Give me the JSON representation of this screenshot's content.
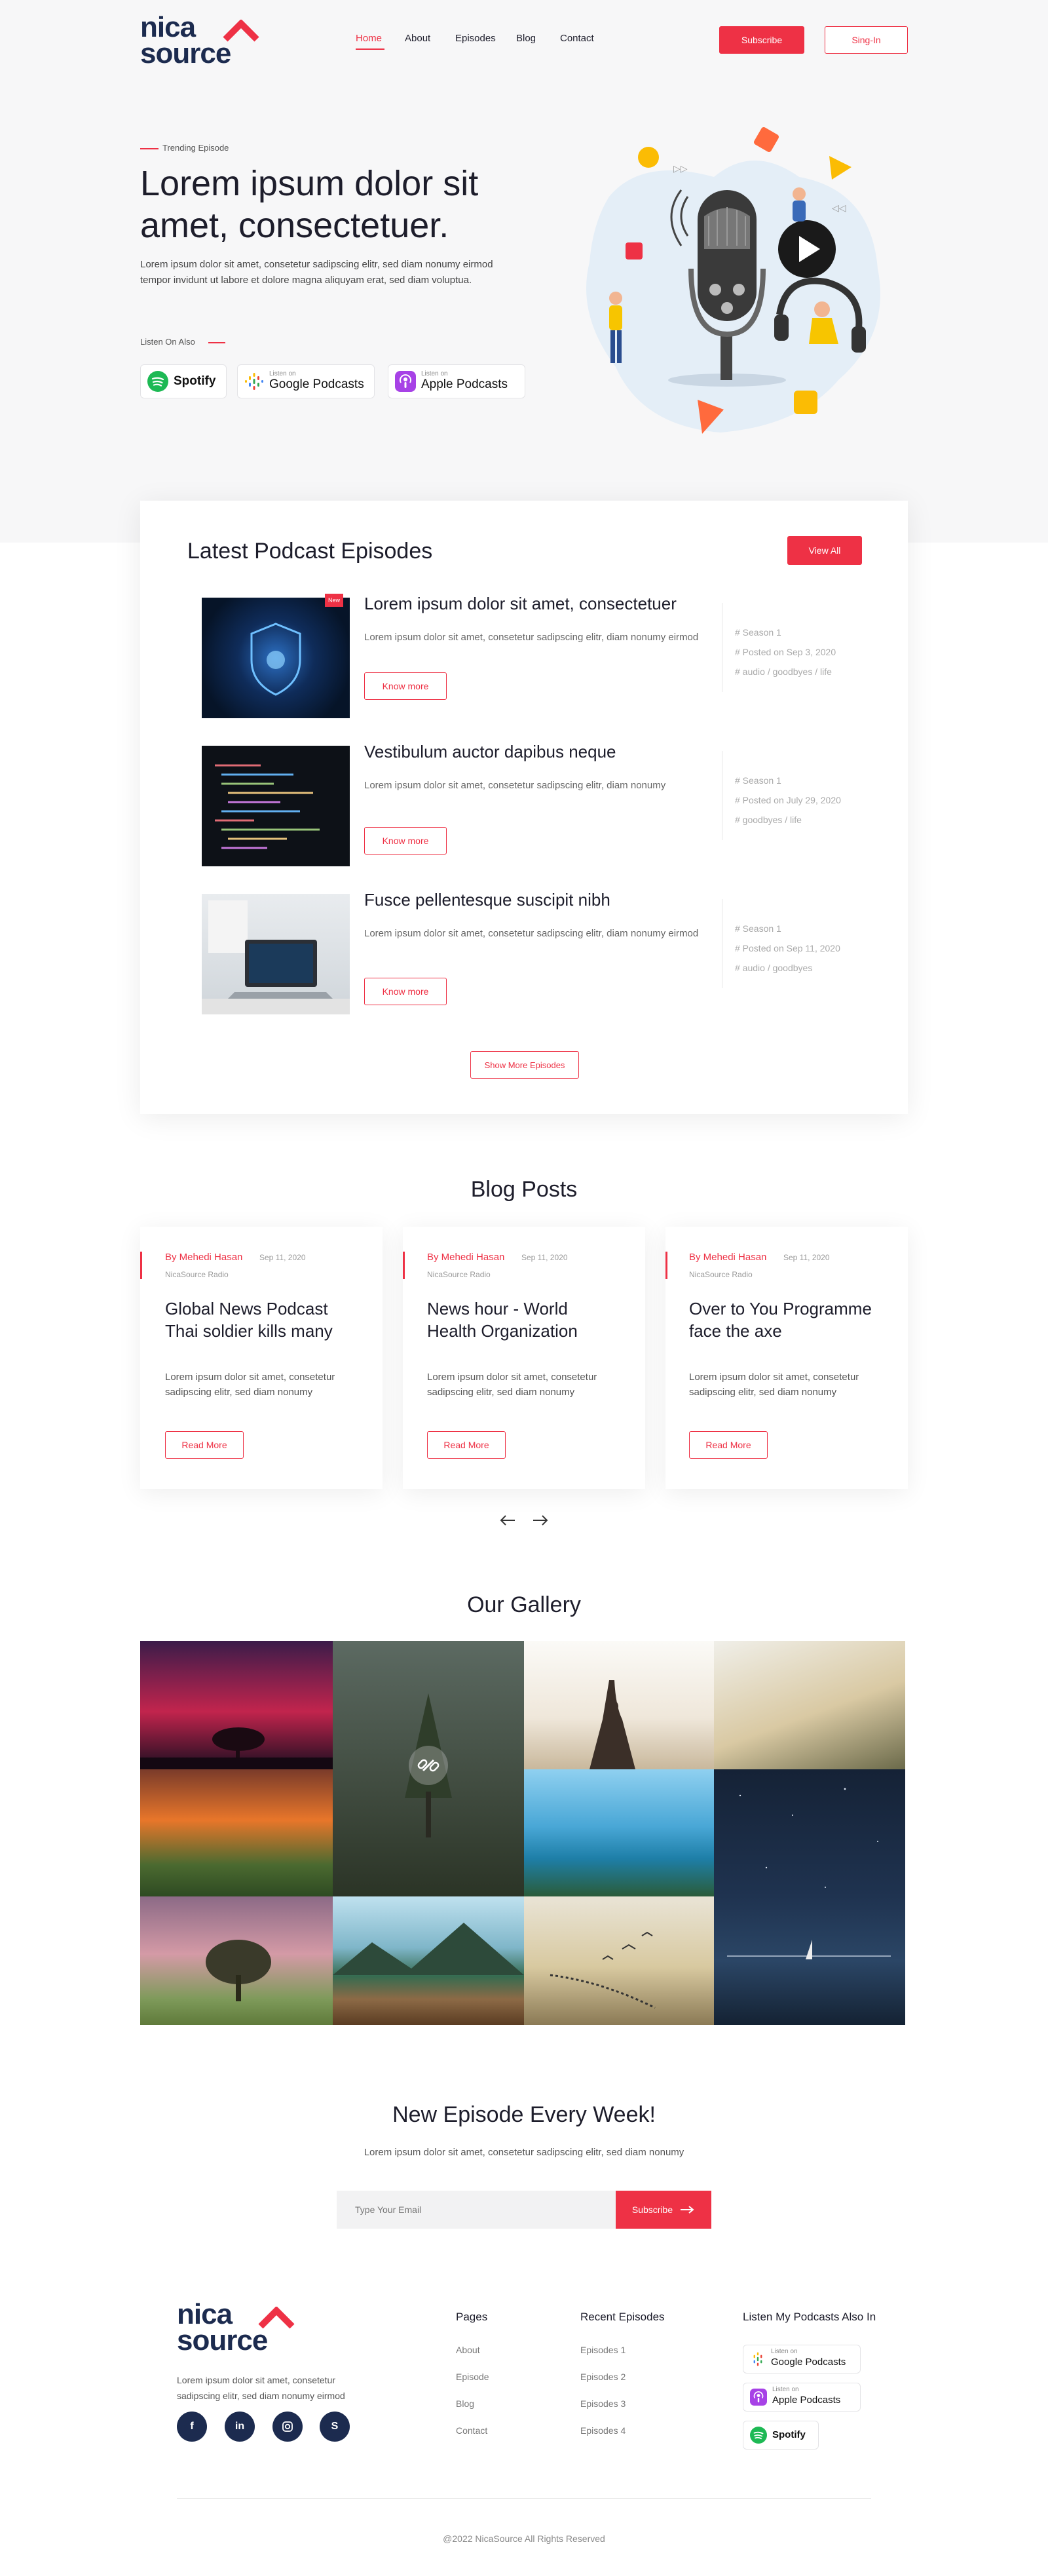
{
  "header": {
    "logo_line1": "nica",
    "logo_line2": "source",
    "nav": [
      "Home",
      "About",
      "Episodes",
      "Blog",
      "Contact"
    ],
    "subscribe_label": "Subscribe",
    "signin_label": "Sing-In"
  },
  "hero": {
    "eyebrow": "Trending Episode",
    "title": "Lorem ipsum dolor sit amet, consectetuer.",
    "description": "Lorem ipsum dolor sit amet, consetetur sadipscing elitr, sed diam nonumy eirmod tempor invidunt ut labore et dolore magna aliquyam erat, sed diam voluptua.",
    "listen_label": "Listen On Also",
    "platforms": [
      {
        "small": "",
        "big": "Spotify"
      },
      {
        "small": "Listen on",
        "big": "Google Podcasts"
      },
      {
        "small": "Listen on",
        "big": "Apple Podcasts"
      }
    ]
  },
  "episodes": {
    "heading": "Latest Podcast Episodes",
    "view_all": "View All",
    "new_badge": "New",
    "items": [
      {
        "title": "Lorem ipsum dolor sit amet, consectetuer",
        "desc": "Lorem ipsum dolor sit amet, consetetur sadipscing elitr, diam nonumy eirmod",
        "button": "Know more",
        "season": "# Season 1",
        "posted": "# Posted on Sep 3, 2020",
        "tags": "# audio / goodbyes / life"
      },
      {
        "title": "Vestibulum auctor dapibus neque",
        "desc": "Lorem ipsum dolor sit amet, consetetur sadipscing elitr, diam nonumy",
        "button": "Know more",
        "season": "# Season 1",
        "posted": "# Posted on July 29, 2020",
        "tags": "# goodbyes / life"
      },
      {
        "title": "Fusce pellentesque suscipit nibh",
        "desc": "Lorem ipsum dolor sit amet, consetetur sadipscing elitr, diam nonumy eirmod",
        "button": "Know more",
        "season": "# Season 1",
        "posted": "# Posted on Sep 11, 2020",
        "tags": "# audio / goodbyes"
      }
    ],
    "show_more": "Show More Episodes"
  },
  "blog": {
    "heading": "Blog Posts",
    "posts": [
      {
        "author": "By Mehedi Hasan",
        "date": "Sep 11, 2020",
        "source": "NicaSource Radio",
        "title": "Global News Podcast Thai soldier kills many",
        "excerpt": "Lorem ipsum dolor sit amet, consetetur sadipscing elitr, sed diam nonumy",
        "button": "Read More"
      },
      {
        "author": "By Mehedi Hasan",
        "date": "Sep 11, 2020",
        "source": "NicaSource Radio",
        "title": "News hour - World Health Organization",
        "excerpt": "Lorem ipsum dolor sit amet, consetetur sadipscing elitr, sed diam nonumy",
        "button": "Read More"
      },
      {
        "author": "By Mehedi Hasan",
        "date": "Sep 11, 2020",
        "source": "NicaSource Radio",
        "title": "Over to You Programme face the axe",
        "excerpt": "Lorem ipsum dolor sit amet, consetetur sadipscing elitr, sed diam nonumy",
        "button": "Read More"
      }
    ]
  },
  "gallery": {
    "heading": "Our Gallery"
  },
  "newsletter": {
    "heading": "New Episode Every Week!",
    "text": "Lorem ipsum dolor sit amet, consetetur sadipscing elitr, sed diam nonumy",
    "placeholder": "Type Your Email",
    "button": "Subscribe"
  },
  "footer": {
    "about": "Lorem ipsum dolor sit amet, consetetur sadipscing elitr, sed diam nonumy eirmod",
    "pages_heading": "Pages",
    "pages": [
      "About",
      "Episode",
      "Blog",
      "Contact"
    ],
    "recent_heading": "Recent Episodes",
    "recent": [
      "Episodes 1",
      "Episodes 2",
      "Episodes 3",
      "Episodes 4"
    ],
    "listen_heading": "Listen My Podcasts Also In",
    "copyright": "@2022 NicaSource All Rights Reserved"
  },
  "colors": {
    "accent": "#ee3145",
    "navy": "#1c2b4f"
  }
}
